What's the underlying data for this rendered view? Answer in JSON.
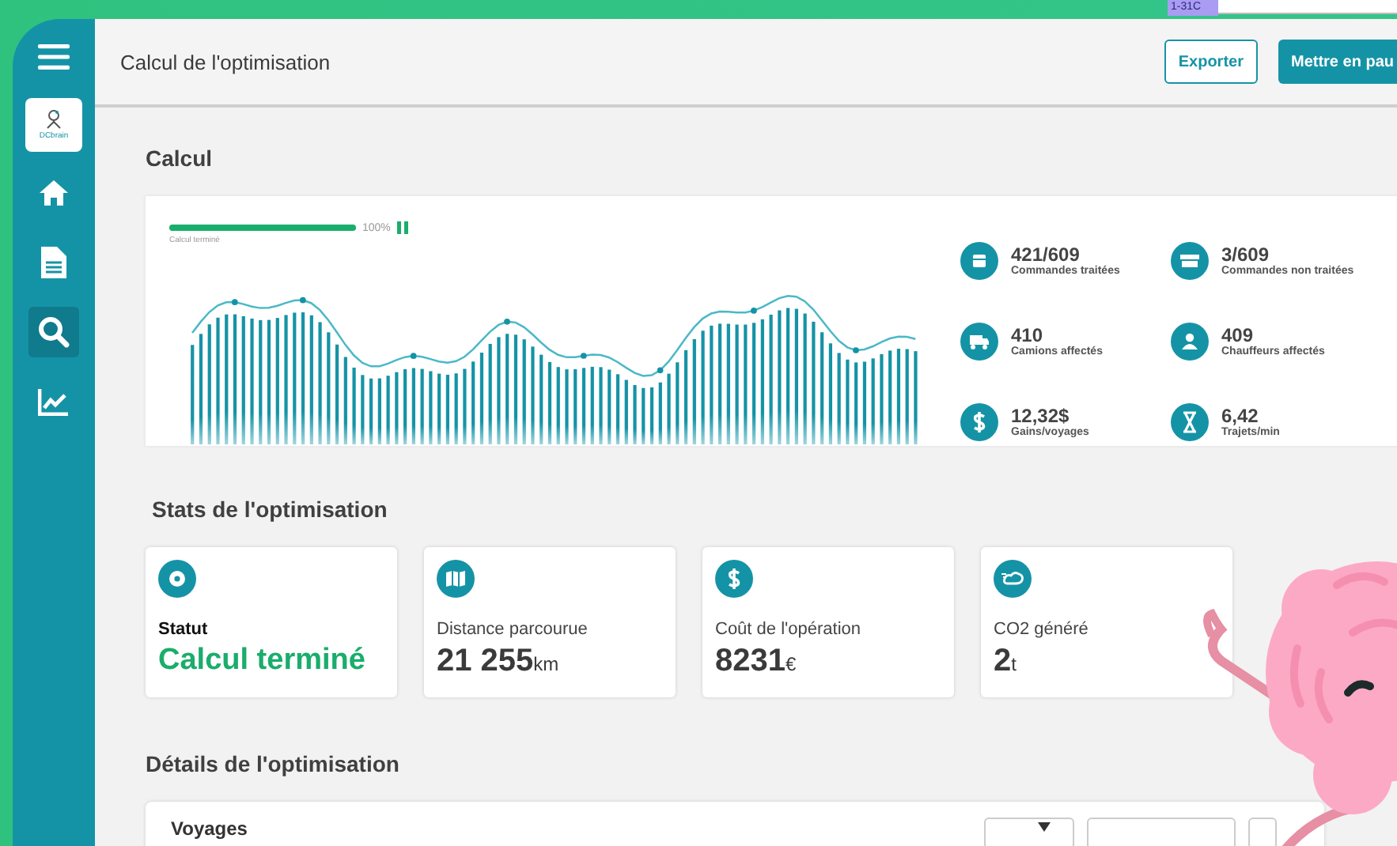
{
  "top_tag": "1-31C",
  "sidebar": {
    "logo": "DCbrain",
    "items": [
      {
        "selected": false
      },
      {
        "selected": false
      },
      {
        "selected": true
      },
      {
        "selected": false
      }
    ]
  },
  "header": {
    "title": "Calcul de l'optimisation",
    "buttons": [
      {
        "label": "Exporter",
        "kind": "outline"
      },
      {
        "label": "Mettre en pau",
        "kind": "filled"
      }
    ]
  },
  "calcul": {
    "heading": "Calcul",
    "progress": {
      "level": 1,
      "percent": "100%",
      "caption": "Calcul terminé"
    },
    "stats": [
      {
        "value": "421/609",
        "label": "Commandes traitées"
      },
      {
        "value": "3/609",
        "label": "Commandes non traitées"
      },
      {
        "value": "410",
        "label": "Camions affectés"
      },
      {
        "value": "409",
        "label": "Chauffeurs affectés"
      },
      {
        "value": "12,32$",
        "label": "Gains/voyages"
      },
      {
        "value": "6,42",
        "label": "Trajets/min"
      }
    ]
  },
  "stats_section": {
    "heading": "Stats de l'optimisation",
    "cards": [
      {
        "kind": "status",
        "label": "Statut",
        "value": "Calcul terminé"
      },
      {
        "kind": "measure",
        "label": "Distance parcourue",
        "value": "21 255",
        "unit": "km"
      },
      {
        "kind": "measure",
        "label": "Coût de l'opération",
        "value": "8231",
        "unit": "€"
      },
      {
        "kind": "measure",
        "label": "CO2 généré",
        "value": "2",
        "unit": "t"
      }
    ]
  },
  "details": {
    "heading": "Détails de l'optimisation",
    "card_title": "Voyages"
  }
}
